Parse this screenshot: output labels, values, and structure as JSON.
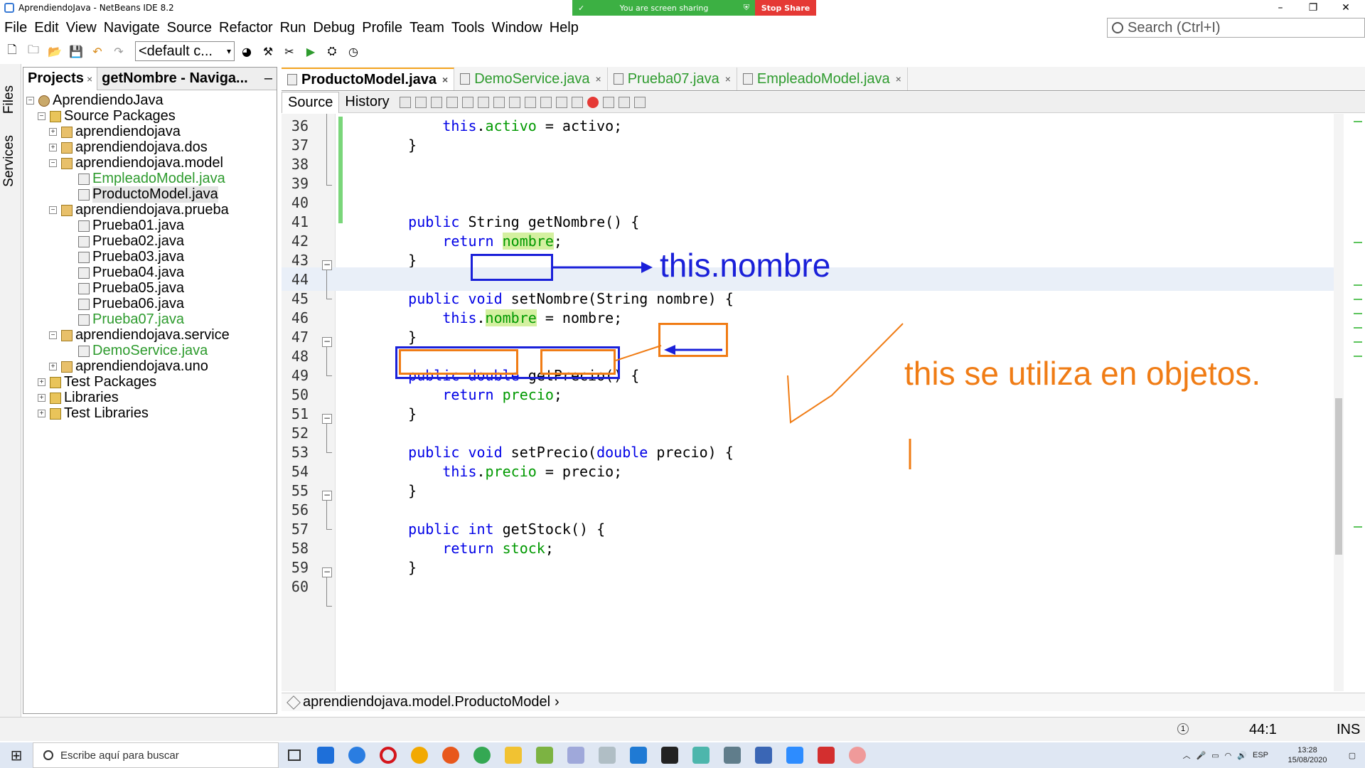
{
  "window": {
    "title": "AprendiendoJava - NetBeans IDE 8.2",
    "minimize": "–",
    "maximize": "❐",
    "close": "✕"
  },
  "share": {
    "status": "You are screen sharing",
    "stop": "Stop Share"
  },
  "menu": [
    "File",
    "Edit",
    "View",
    "Navigate",
    "Source",
    "Refactor",
    "Run",
    "Debug",
    "Profile",
    "Team",
    "Tools",
    "Window",
    "Help"
  ],
  "search": {
    "placeholder": "Search (Ctrl+I)"
  },
  "toolbar": {
    "config": "<default c..."
  },
  "side_tabs": {
    "files": "Files",
    "services": "Services"
  },
  "project_panel": {
    "tabs": [
      "Projects",
      "getNombre - Naviga..."
    ],
    "tree": [
      {
        "label": "AprendiendoJava",
        "icon": "project-icon",
        "exp": "−"
      },
      {
        "label": "Source Packages",
        "icon": "folder-icon",
        "exp": "−"
      },
      {
        "label": "aprendiendojava",
        "icon": "package-icon",
        "exp": "+"
      },
      {
        "label": "aprendiendojava.dos",
        "icon": "package-icon",
        "exp": "+"
      },
      {
        "label": "aprendiendojava.model",
        "icon": "package-icon",
        "exp": "−"
      },
      {
        "label": "EmpleadoModel.java",
        "icon": "java-file-icon",
        "exp": "",
        "color": "green"
      },
      {
        "label": "ProductoModel.java",
        "icon": "java-file-icon",
        "exp": "",
        "selected": true
      },
      {
        "label": "aprendiendojava.prueba",
        "icon": "package-icon",
        "exp": "−"
      },
      {
        "label": "Prueba01.java",
        "icon": "java-file-icon",
        "exp": ""
      },
      {
        "label": "Prueba02.java",
        "icon": "java-file-icon",
        "exp": ""
      },
      {
        "label": "Prueba03.java",
        "icon": "java-file-icon",
        "exp": ""
      },
      {
        "label": "Prueba04.java",
        "icon": "java-file-icon",
        "exp": ""
      },
      {
        "label": "Prueba05.java",
        "icon": "java-file-icon",
        "exp": ""
      },
      {
        "label": "Prueba06.java",
        "icon": "java-file-icon",
        "exp": ""
      },
      {
        "label": "Prueba07.java",
        "icon": "java-file-icon",
        "exp": "",
        "color": "green"
      },
      {
        "label": "aprendiendojava.service",
        "icon": "package-icon",
        "exp": "−"
      },
      {
        "label": "DemoService.java",
        "icon": "java-file-icon",
        "exp": "",
        "color": "green"
      },
      {
        "label": "aprendiendojava.uno",
        "icon": "package-icon",
        "exp": "+"
      },
      {
        "label": "Test Packages",
        "icon": "folder-icon",
        "exp": "+"
      },
      {
        "label": "Libraries",
        "icon": "folder-icon",
        "exp": "+"
      },
      {
        "label": "Test Libraries",
        "icon": "folder-icon",
        "exp": "+"
      }
    ]
  },
  "editor": {
    "tabs": [
      {
        "label": "ProductoModel.java",
        "active": true
      },
      {
        "label": "DemoService.java",
        "color": "green"
      },
      {
        "label": "Prueba07.java",
        "color": "green"
      },
      {
        "label": "EmpleadoModel.java",
        "color": "green"
      }
    ],
    "subtabs": [
      "Source",
      "History"
    ],
    "lines": [
      {
        "n": "36",
        "html": "        <span class='kw'>this</span>.<span class='fld'>activo</span> = activo;"
      },
      {
        "n": "37",
        "html": "    }"
      },
      {
        "n": "38",
        "html": ""
      },
      {
        "n": "39",
        "html": ""
      },
      {
        "n": "40",
        "html": ""
      },
      {
        "n": "41",
        "html": "    <span class='kw'>public</span> String getNombre() {"
      },
      {
        "n": "42",
        "html": "        <span class='kw'>return</span> <span class='fld hl'>nombre</span>;"
      },
      {
        "n": "43",
        "html": "    }"
      },
      {
        "n": "44",
        "html": ""
      },
      {
        "n": "45",
        "html": "    <span class='kw'>public void</span> setNombre(String nombre) {"
      },
      {
        "n": "46",
        "html": "        <span class='kw'>this</span>.<span class='fld hl'>nombre</span> = nombre;"
      },
      {
        "n": "47",
        "html": "    }"
      },
      {
        "n": "48",
        "html": ""
      },
      {
        "n": "49",
        "html": "    <span class='kw'>public double</span> getPrecio() {"
      },
      {
        "n": "50",
        "html": "        <span class='kw'>return</span> <span class='fld'>precio</span>;"
      },
      {
        "n": "51",
        "html": "    }"
      },
      {
        "n": "52",
        "html": ""
      },
      {
        "n": "53",
        "html": "    <span class='kw'>public void</span> setPrecio(<span class='kw'>double</span> precio) {"
      },
      {
        "n": "54",
        "html": "        <span class='kw'>this</span>.<span class='fld'>precio</span> = precio;"
      },
      {
        "n": "55",
        "html": "    }"
      },
      {
        "n": "56",
        "html": ""
      },
      {
        "n": "57",
        "html": "    <span class='kw'>public int</span> getStock() {"
      },
      {
        "n": "58",
        "html": "        <span class='kw'>return</span> <span class='fld'>stock</span>;"
      },
      {
        "n": "59",
        "html": "    }"
      },
      {
        "n": "60",
        "html": ""
      }
    ],
    "current_line": "44",
    "breadcrumb": "aprendiendojava.model.ProductoModel"
  },
  "annotations": {
    "blue_text": "this.nombre",
    "orange_text": "this se utiliza en objetos."
  },
  "status": {
    "position": "44:1",
    "mode": "INS",
    "notif": "1"
  },
  "taskbar": {
    "search_placeholder": "Escribe aquí para buscar",
    "lang": "ESP",
    "time": "13:28",
    "date": "15/08/2020"
  },
  "colors": {
    "keyword": "#0000e6",
    "field": "#009900",
    "annotation_blue": "#1a20d9",
    "annotation_orange": "#f07c15",
    "share_green": "#3cb043",
    "share_red": "#e53935"
  }
}
